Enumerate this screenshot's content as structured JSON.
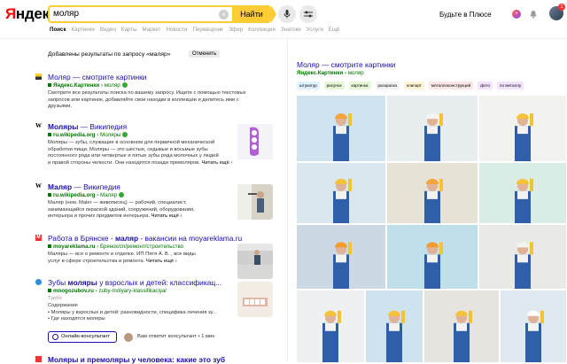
{
  "header": {
    "logo": "Яндекс",
    "logo_red_letter": "Я",
    "logo_rest": "ндекс",
    "query": "моляр",
    "search_button": "Найти",
    "plus_label": "Будьте в Плюсе",
    "plus_badge": "+",
    "avatar_badge": "1"
  },
  "tabs": [
    "Поиск",
    "Картинки",
    "Видео",
    "Карты",
    "Маркет",
    "Новости",
    "Переводчик",
    "Эфир",
    "Коллекции",
    "Знатоки",
    "Услуги",
    "Ещё"
  ],
  "correction": {
    "text": "Добавлены результаты по запросу",
    "term": "«маляр»",
    "cancel": "Отменить"
  },
  "results": [
    {
      "favicon": "images-icon",
      "title": "Моляр — смотрите картинки",
      "url_bold": "Яндекс.Картинки",
      "url_rest": "› моляр",
      "snippet": [
        "Смотрите все результаты поиска по вашему запросу. Ищите с помощью текстовых",
        "запросов или картинок, добавляйте свои находки в коллекции и делитесь ими с",
        "друзьями."
      ]
    },
    {
      "favicon": "wikipedia-icon",
      "title_bold": "Моляры",
      "title_rest": " — Википедия",
      "url_bold": "ru.wikipedia.org",
      "url_rest": "› Моляры",
      "snippet": [
        "Моляры — зубы, служащие в основном для первичной механической",
        "обработки пищи. Моляры — это шестые, седьмые и восьмые зубы",
        "постоянного ряда или четвертые и пятые зубы ряда молочных у людей",
        "и правой стороны челюсти. Они находятся позади премоляров."
      ],
      "more": "Читать ещё ›"
    },
    {
      "favicon": "wikipedia-icon",
      "title_bold": "Маляр",
      "title_rest": " — Википедия",
      "url_bold": "ru.wikipedia.org",
      "url_rest": "› Маляр",
      "snippet": [
        "Маляр (нем. Maler — живописец) — рабочий, специалист,",
        "занимающийся окраской зданий, сооружений, оборудования,",
        "интерьера и прочих предметов интерьера."
      ],
      "more": "Читать ещё ›"
    },
    {
      "favicon": "moyareklama-icon",
      "title_a": "Работа в Брянске - ",
      "title_bold": "маляр",
      "title_rest": " - вакансии на moyareklama.ru",
      "url_bold": "moyareklama.ru",
      "url_rest": "› Брянск/сп/ремонт/строительство",
      "snippet": [
        "Маляры — все о ремонте и отделке. ИП Пятя А. В. , все виды",
        "услуг в сфере строительства и ремонта."
      ],
      "more": "Читать ещё ›"
    },
    {
      "favicon": "mnogozubov-icon",
      "title_a": "Зубы ",
      "title_bold": "моляры",
      "title_rest": " у взрослых и детей: классификац...",
      "url_bold": "mnogozubov.ru",
      "url_rest": "› zuby-molyary-klassifikaciya/",
      "badge": "Турбо",
      "snippet": [
        "Содержание",
        "• Моляры у взрослых и детей: разновидности, специфика лечения зу...",
        "• Где находятся моляры"
      ],
      "consult_button": "Онлайн-консультант",
      "consult_note": "Вам ответит консультант • 1 мин"
    },
    {
      "favicon": "images-icon",
      "title": "Моляры и премоляры у человека: какие это зуб"
    }
  ],
  "panel": {
    "title": "Моляр — смотрите картинки",
    "url_bold": "Яндекс.Картинки",
    "url_rest": "› моляр",
    "chips": [
      {
        "label": "штукатур",
        "color": "#dff2ff"
      },
      {
        "label": "рисунок",
        "color": "#e6f7d8"
      },
      {
        "label": "картинка",
        "color": "#e6f7d8"
      },
      {
        "label": "раскраска",
        "color": "#f2f2f2"
      },
      {
        "label": "клипарт",
        "color": "#fff4d4"
      },
      {
        "label": "металлоконструкций",
        "color": "#fde6e6"
      },
      {
        "label": "фото",
        "color": "#f3e3ff"
      },
      {
        "label": "по металлу",
        "color": "#f3e3ff"
      }
    ]
  },
  "colors": {
    "accent": "#ffcc33",
    "link": "#1a0dab",
    "url": "#007700"
  }
}
